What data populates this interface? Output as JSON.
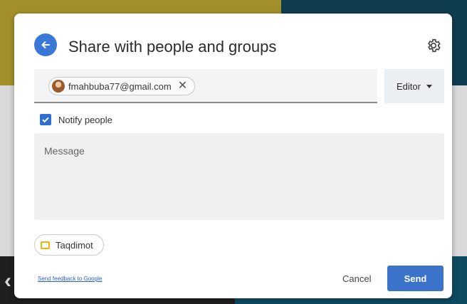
{
  "dialog": {
    "title": "Share with people and groups",
    "back_icon": "arrow-left-icon",
    "settings_icon": "gear-icon"
  },
  "recipients": {
    "chips": [
      {
        "email": "fmahbuba77@gmail.com",
        "avatar_icon": "avatar",
        "remove_icon": "close-icon",
        "remove_glyph": "✕"
      }
    ]
  },
  "role_select": {
    "value": "Editor",
    "icon": "chevron-down-icon"
  },
  "notify": {
    "checked": true,
    "label": "Notify people"
  },
  "message": {
    "placeholder": "Message"
  },
  "attachment": {
    "icon": "slides-icon",
    "label": "Taqdimot",
    "icon_color": "#f2b400"
  },
  "footer": {
    "feedback_link": "Send feedback to Google",
    "cancel_label": "Cancel",
    "send_label": "Send"
  },
  "colors": {
    "accent": "#3a73c9",
    "back_button": "#3a78d8",
    "checkbox": "#2f6fd1"
  }
}
